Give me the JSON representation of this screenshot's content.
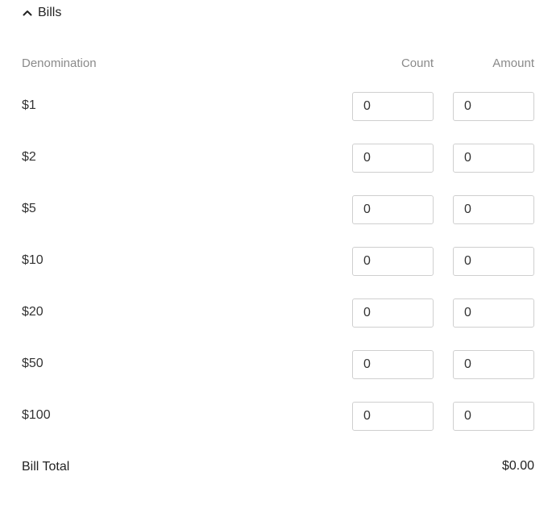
{
  "section": {
    "title": "Bills",
    "expanded": true
  },
  "columns": {
    "denomination": "Denomination",
    "count": "Count",
    "amount": "Amount"
  },
  "rows": [
    {
      "label": "$1",
      "count": "0",
      "amount": "0"
    },
    {
      "label": "$2",
      "count": "0",
      "amount": "0"
    },
    {
      "label": "$5",
      "count": "0",
      "amount": "0"
    },
    {
      "label": "$10",
      "count": "0",
      "amount": "0"
    },
    {
      "label": "$20",
      "count": "0",
      "amount": "0"
    },
    {
      "label": "$50",
      "count": "0",
      "amount": "0"
    },
    {
      "label": "$100",
      "count": "0",
      "amount": "0"
    }
  ],
  "total": {
    "label": "Bill Total",
    "value": "$0.00"
  }
}
